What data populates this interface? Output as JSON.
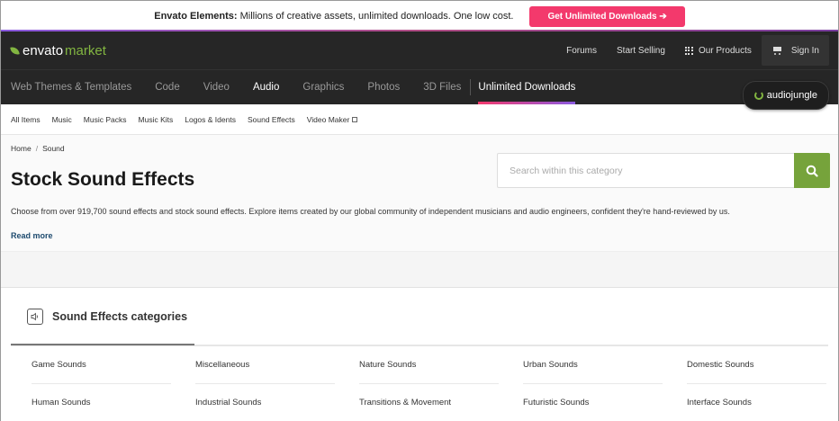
{
  "promo": {
    "brand": "Envato Elements:",
    "text": "Millions of creative assets, unlimited downloads. One low cost.",
    "button": "Get Unlimited Downloads ➔"
  },
  "topnav": {
    "logo_a": "envato",
    "logo_b": "market",
    "links": [
      "Forums",
      "Start Selling",
      "Our Products"
    ],
    "signin": "Sign In"
  },
  "catnav": {
    "items": [
      "Web Themes & Templates",
      "Code",
      "Video",
      "Audio",
      "Graphics",
      "Photos",
      "3D Files"
    ],
    "active": "Audio",
    "unlimited": "Unlimited Downloads",
    "badge": "audiojungle"
  },
  "subnav": {
    "items": [
      "All Items",
      "Music",
      "Music Packs",
      "Music Kits",
      "Logos & Idents",
      "Sound Effects",
      "Video Maker"
    ]
  },
  "hero": {
    "crumbs": [
      "Home",
      "Sound"
    ],
    "title": "Stock Sound Effects",
    "description": "Choose from over 919,700 sound effects and stock sound effects. Explore items created by our global community of independent musicians and audio engineers, confident they're hand-reviewed by us.",
    "read_more": "Read more",
    "search_placeholder": "Search within this category"
  },
  "categories": {
    "heading": "Sound Effects categories",
    "items": [
      "Game Sounds",
      "Miscellaneous",
      "Nature Sounds",
      "Urban Sounds",
      "Domestic Sounds",
      "Human Sounds",
      "Industrial Sounds",
      "Transitions & Movement",
      "Futuristic Sounds",
      "Interface Sounds"
    ]
  },
  "colors": {
    "promo_button": "#f3396c",
    "nav_bg": "#262626",
    "brand_green": "#82b541",
    "search_button": "#76a33b"
  }
}
